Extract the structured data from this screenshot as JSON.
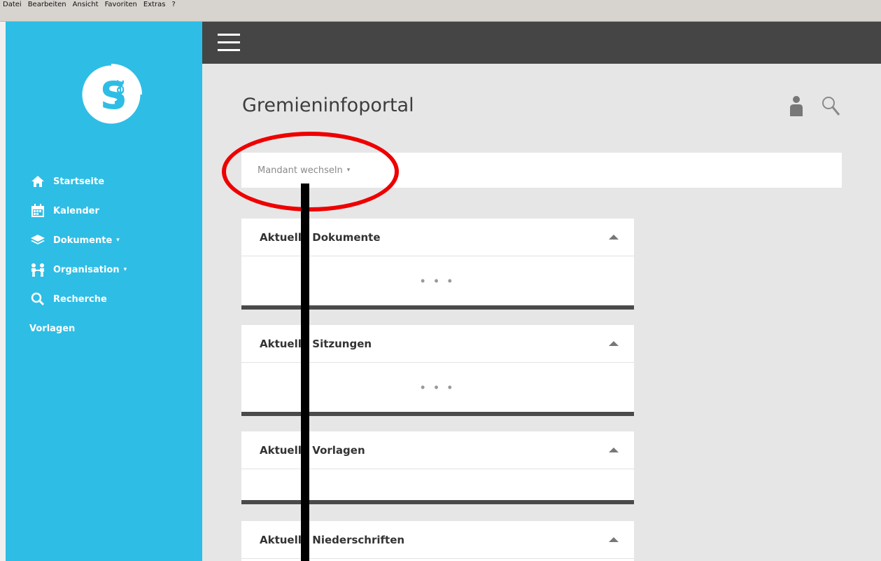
{
  "menubar": {
    "items": [
      "Datei",
      "Bearbeiten",
      "Ansicht",
      "Favoriten",
      "Extras",
      "?"
    ]
  },
  "sidebar": {
    "logo": {
      "letter": "S",
      "subtext": "Net"
    },
    "items": [
      {
        "label": "Startseite",
        "icon": "home-icon"
      },
      {
        "label": "Kalender",
        "icon": "calendar-icon"
      },
      {
        "label": "Dokumente",
        "icon": "layers-icon",
        "caret": "▾"
      },
      {
        "label": "Organisation",
        "icon": "people-icon",
        "caret": "▾"
      },
      {
        "label": "Recherche",
        "icon": "search-icon"
      },
      {
        "label": "Vorlagen"
      }
    ]
  },
  "header": {
    "title": "Gremieninfoportal"
  },
  "mandant": {
    "label": "Mandant wechseln",
    "caret": "▾"
  },
  "panels": [
    {
      "title": "Aktuelle Dokumente",
      "loading": "• • •"
    },
    {
      "title": "Aktuelle Sitzungen",
      "loading": "• • •"
    },
    {
      "title": "Aktuelle Vorlagen",
      "loading": ""
    },
    {
      "title": "Aktuelle Niederschriften",
      "loading": ""
    }
  ],
  "colors": {
    "sidebar": "#2ebde5",
    "topbar": "#454545",
    "content_bg": "#e6e6e6",
    "annotation_red": "#ee0000"
  }
}
